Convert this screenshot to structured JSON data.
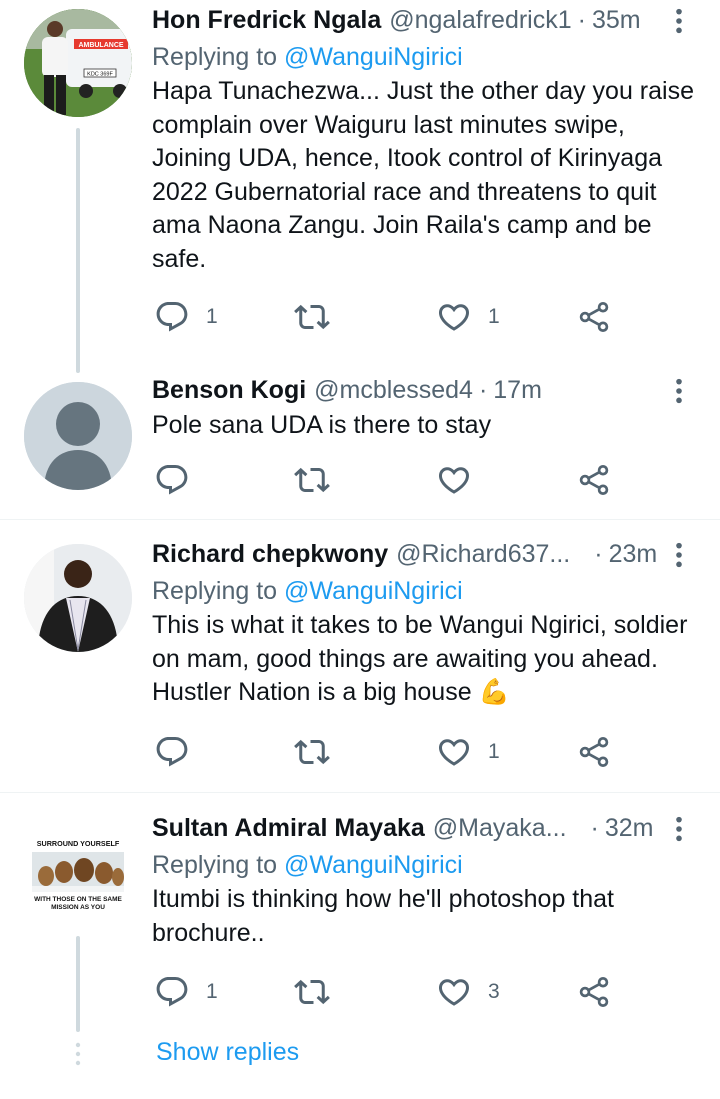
{
  "tweets": [
    {
      "name": "Hon Fredrick Ngala",
      "handle": "@ngalafredrick1",
      "time": "35m",
      "replying_label": "Replying to",
      "replying_to": "@WanguiNgirici",
      "text": "Hapa Tunachezwa... Just the other day you raise complain over Waiguru last minutes swipe, Joining UDA, hence,  Itook control of Kirinyaga 2022 Gubernatorial race and threatens to quit ama Naona Zangu. Join Raila's camp and be safe.",
      "replies": "1",
      "retweets": "",
      "likes": "1"
    },
    {
      "name": "Benson Kogi",
      "handle": "@mcblessed4",
      "time": "17m",
      "text": "Pole sana UDA is there to stay",
      "replies": "",
      "retweets": "",
      "likes": ""
    },
    {
      "name": "Richard chepkwony",
      "handle": "@Richard637...",
      "time": "23m",
      "replying_label": "Replying to",
      "replying_to": "@WanguiNgirici",
      "text": "This is what it takes to be Wangui Ngirici, soldier on mam, good things are awaiting you ahead. Hustler Nation is a big house 💪",
      "replies": "",
      "retweets": "",
      "likes": "1"
    },
    {
      "name": "Sultan Admiral Mayaka",
      "handle": "@Mayaka...",
      "time": "32m",
      "replying_label": "Replying to",
      "replying_to": "@WanguiNgirici",
      "text": "Itumbi is thinking how he'll photoshop that brochure..",
      "replies": "1",
      "retweets": "",
      "likes": "3",
      "avatar_text_top": "SURROUND YOURSELF",
      "avatar_text_bottom": "WITH THOSE ON THE SAME MISSION AS YOU"
    }
  ],
  "show_replies": "Show replies",
  "ambulance_label": "AMBULANCE",
  "plate_label": "KDC 369F",
  "colors": {
    "accent": "#1d9bf0",
    "muted": "#536471",
    "line": "#cfd9de"
  }
}
